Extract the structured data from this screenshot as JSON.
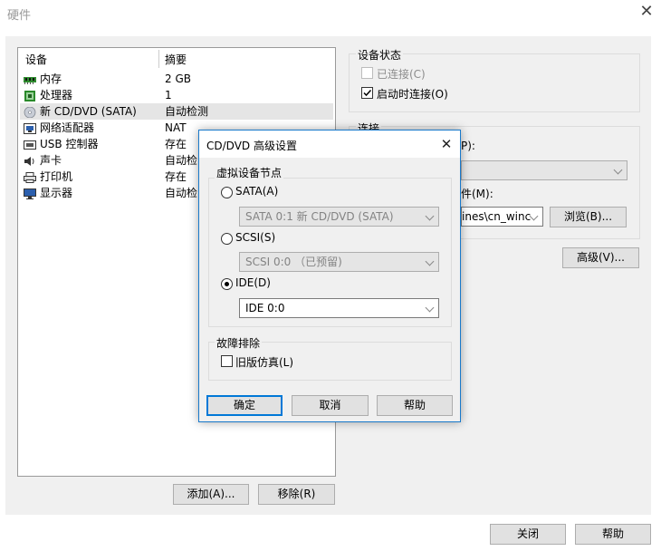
{
  "window": {
    "title": "硬件",
    "close_icon": "close-icon"
  },
  "hardware_list": {
    "col_device": "设备",
    "col_summary": "摘要",
    "items": [
      {
        "name": "内存",
        "summary": "2 GB",
        "icon": "memory-icon"
      },
      {
        "name": "处理器",
        "summary": "1",
        "icon": "processor-icon"
      },
      {
        "name": "新 CD/DVD (SATA)",
        "summary": "自动检测",
        "icon": "cd-dvd-icon",
        "selected": true
      },
      {
        "name": "网络适配器",
        "summary": "NAT",
        "icon": "network-adapter-icon"
      },
      {
        "name": "USB 控制器",
        "summary": "存在",
        "icon": "usb-icon"
      },
      {
        "name": "声卡",
        "summary": "自动检",
        "icon": "sound-card-icon"
      },
      {
        "name": "打印机",
        "summary": "存在",
        "icon": "printer-icon"
      },
      {
        "name": "显示器",
        "summary": "自动检",
        "icon": "display-icon"
      }
    ],
    "add_button": "添加(A)...",
    "remove_button": "移除(R)"
  },
  "device_status": {
    "group_label": "设备状态",
    "connected_label": "已连接(C)",
    "connected_checked": false,
    "connected_enabled": false,
    "connect_on_start_label": "启动时连接(O)",
    "connect_on_start_checked": true
  },
  "connection": {
    "group_label": "连接",
    "partial_label_1": "P):",
    "partial_label_2": "件(M):",
    "iso_path_partial": "ines\\cn_winc",
    "browse_button": "浏览(B)...",
    "advanced_button": "高级(V)..."
  },
  "footer": {
    "close_button": "关闭",
    "help_button": "帮助"
  },
  "dialog": {
    "title": "CD/DVD 高级设置",
    "node_group_label": "虚拟设备节点",
    "sata_label": "SATA(A)",
    "sata_value": "SATA 0:1   新 CD/DVD (SATA)",
    "scsi_label": "SCSI(S)",
    "scsi_value": "SCSI 0:0 （已预留)",
    "ide_label": "IDE(D)",
    "ide_value": "IDE 0:0",
    "selected_node": "IDE",
    "troubleshoot_group_label": "故障排除",
    "legacy_label": "旧版仿真(L)",
    "legacy_checked": false,
    "ok_button": "确定",
    "cancel_button": "取消",
    "help_button": "帮助"
  }
}
